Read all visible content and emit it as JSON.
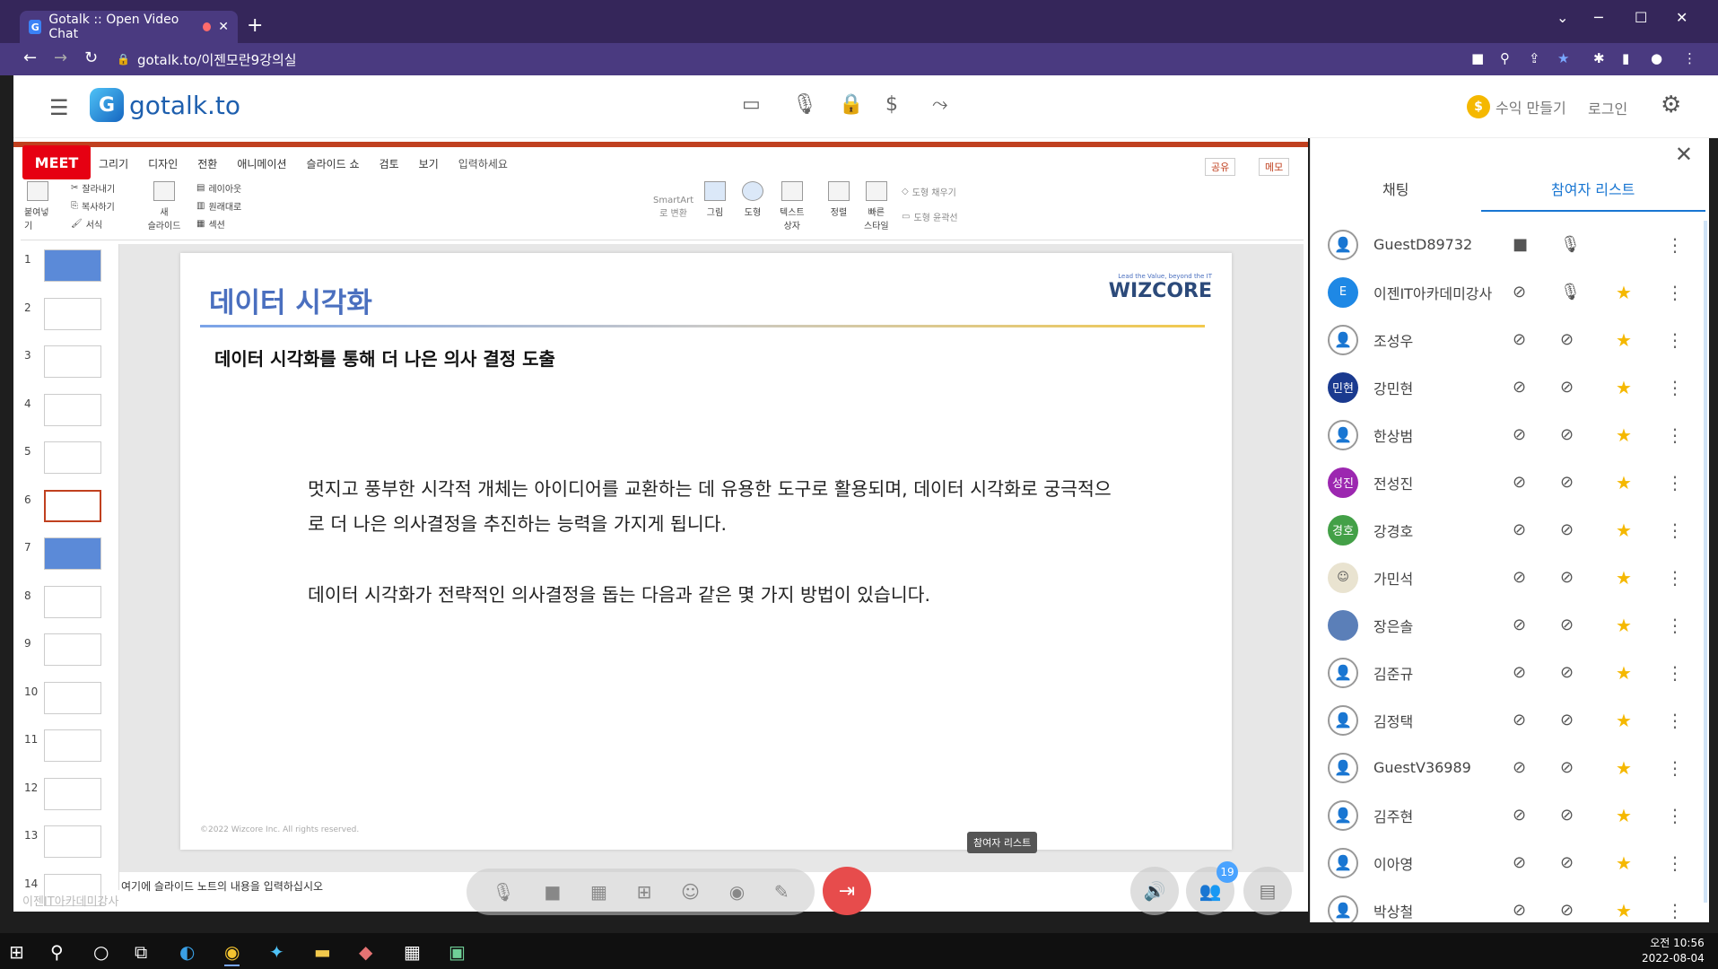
{
  "browser": {
    "tab_title": "Gotalk :: Open Video Chat",
    "favicon_letter": "G",
    "url": "gotalk.to/이젠모란9강의실",
    "new_tab": "+",
    "close_tab": "✕",
    "win_min": "─",
    "win_max": "☐",
    "win_close": "✕",
    "tab_search": "⌄"
  },
  "app": {
    "logo_text": "gotalk.to",
    "logo_mark": "G",
    "revenue_label": "수익 만들기",
    "revenue_coin": "$",
    "login_label": "로그인",
    "accent_color": "#1976d2"
  },
  "ppt": {
    "meet_badge": "MEET",
    "menu": [
      "그리기",
      "디자인",
      "전환",
      "애니메이션",
      "슬라이드 쇼",
      "검토",
      "보기",
      "입력하세요"
    ],
    "share_label": "공유",
    "memo_label": "메모",
    "ribbon": {
      "paste": "붙여넣기",
      "cut": "잘라내기",
      "copy": "복사하기",
      "format": "서식",
      "new_slide": "새\n슬라이드",
      "layout": "레이아웃",
      "reset": "원래대로",
      "section": "섹션",
      "picture": "그림",
      "shape": "도형",
      "textbox": "텍스트\n상자",
      "arrange": "정렬",
      "quick_style": "빠른\n스타일",
      "smartart": "SmartArt\n로 변환",
      "fill": "도형 채우기",
      "outline": "도형 윤곽선"
    },
    "thumb_numbers": [
      "1",
      "2",
      "3",
      "4",
      "5",
      "6",
      "7",
      "8",
      "9",
      "10",
      "11",
      "12",
      "13",
      "14"
    ],
    "active_slide": 6,
    "slide": {
      "title": "데이터 시각화",
      "logo_tagline": "Lead the Value, beyond the IT",
      "logo_name": "WIZCORE",
      "subtitle": "데이터 시각화를 통해 더 나은 의사 결정 도출",
      "para1": "멋지고 풍부한 시각적 개체는 아이디어를 교환하는 데 유용한 도구로 활용되며, 데이터 시각화로 궁극적으로 더 나은 의사결정을 추진하는 능력을 가지게 됩니다.",
      "para2": "데이터 시각화가 전략적인 의사결정을 돕는 다음과 같은 몇 가지 방법이 있습니다.",
      "footer": "©2022  Wizcore Inc. All rights reserved."
    },
    "notes_placeholder": "여기에 슬라이드 노트의 내용을 입력하십시오",
    "watermark": "이젠IT아카데미강사"
  },
  "tooltip": "참여자 리스트",
  "controls": {
    "participants_count": "19"
  },
  "panel": {
    "tab_chat": "채팅",
    "tab_participants": "참여자 리스트",
    "participants": [
      {
        "name": "GuestD89732",
        "avatar": "",
        "avatar_color": "",
        "cam": "on",
        "mic": "on",
        "star": false
      },
      {
        "name": "이젠IT아카데미강사",
        "avatar": "E",
        "avatar_color": "#1e88e5",
        "cam": "off",
        "mic": "on",
        "star": true
      },
      {
        "name": "조성우",
        "avatar": "",
        "avatar_color": "",
        "cam": "off",
        "mic": "off",
        "star": true
      },
      {
        "name": "강민현",
        "avatar": "민현",
        "avatar_color": "#1a3a8f",
        "cam": "off",
        "mic": "off",
        "star": true
      },
      {
        "name": "한상범",
        "avatar": "",
        "avatar_color": "",
        "cam": "off",
        "mic": "off",
        "star": true
      },
      {
        "name": "전성진",
        "avatar": "성진",
        "avatar_color": "#9c27b0",
        "cam": "off",
        "mic": "off",
        "star": true
      },
      {
        "name": "강경호",
        "avatar": "경호",
        "avatar_color": "#43a047",
        "cam": "off",
        "mic": "off",
        "star": true
      },
      {
        "name": "가민석",
        "avatar": "☺",
        "avatar_color": "#e9e3d0",
        "cam": "off",
        "mic": "off",
        "star": true
      },
      {
        "name": "장은솔",
        "avatar": "",
        "avatar_color": "#5b7fb8",
        "cam": "off",
        "mic": "off",
        "star": true
      },
      {
        "name": "김준규",
        "avatar": "",
        "avatar_color": "",
        "cam": "off",
        "mic": "off",
        "star": true
      },
      {
        "name": "김정택",
        "avatar": "",
        "avatar_color": "",
        "cam": "off",
        "mic": "off",
        "star": true
      },
      {
        "name": "GuestV36989",
        "avatar": "",
        "avatar_color": "",
        "cam": "off",
        "mic": "off",
        "star": true
      },
      {
        "name": "김주현",
        "avatar": "",
        "avatar_color": "",
        "cam": "off",
        "mic": "off",
        "star": true
      },
      {
        "name": "이아영",
        "avatar": "",
        "avatar_color": "",
        "cam": "off",
        "mic": "off",
        "star": true
      },
      {
        "name": "박상철",
        "avatar": "",
        "avatar_color": "",
        "cam": "off",
        "mic": "off",
        "star": true
      }
    ]
  },
  "taskbar": {
    "time": "오전 10:56",
    "date": "2022-08-04"
  }
}
